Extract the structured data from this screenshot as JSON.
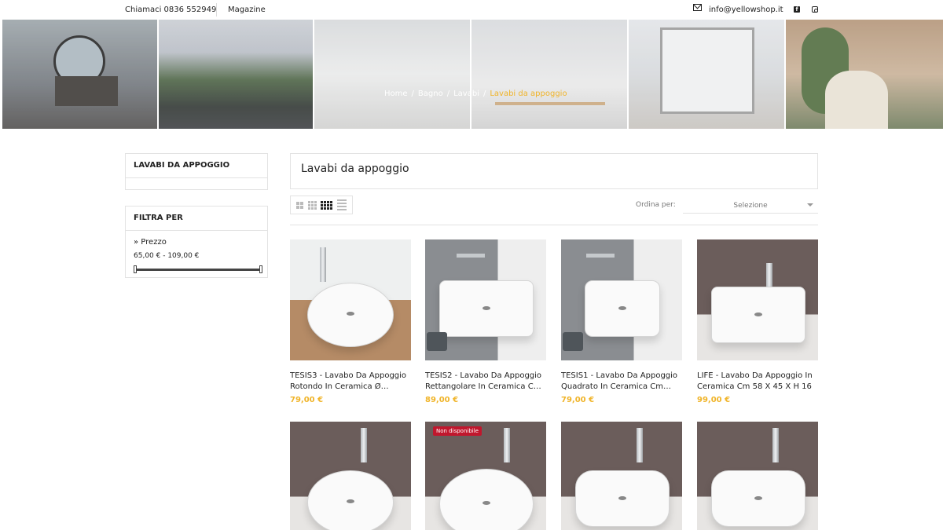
{
  "topbar": {
    "phone": "Chiamaci 0836 552949",
    "magazine": "Magazine",
    "email": "info@yellowshop.it",
    "facebook_icon": "facebook-icon",
    "instagram_icon": "instagram-icon"
  },
  "breadcrumb": {
    "items": [
      "Home",
      "Bagno",
      "Lavabi"
    ],
    "current": "Lavabi da appoggio"
  },
  "sidebar": {
    "category_title": "LAVABI DA APPOGGIO",
    "filter_title": "FILTRA PER",
    "filter_label": "» Prezzo",
    "price_range": "65,00 € - 109,00 €"
  },
  "main": {
    "title": "Lavabi da appoggio",
    "sort_label": "Ordina per:",
    "sort_value": "Selezione"
  },
  "colors": {
    "accent": "#f0b429",
    "badge": "#c0172d"
  },
  "products": [
    {
      "name": "TESIS3 - Lavabo Da Appoggio Rotondo In Ceramica Ø…",
      "price": "79,00 €"
    },
    {
      "name": "TESIS2 - Lavabo Da Appoggio Rettangolare In Ceramica C…",
      "price": "89,00 €"
    },
    {
      "name": "TESIS1 - Lavabo Da Appoggio Quadrato In Ceramica Cm…",
      "price": "79,00 €"
    },
    {
      "name": "LIFE - Lavabo Da Appoggio In Ceramica Cm 58 X 45 X H 16",
      "price": "99,00 €"
    },
    {
      "badge": ""
    },
    {
      "badge": "Non disponibile"
    },
    {
      "badge": ""
    },
    {
      "badge": ""
    }
  ]
}
